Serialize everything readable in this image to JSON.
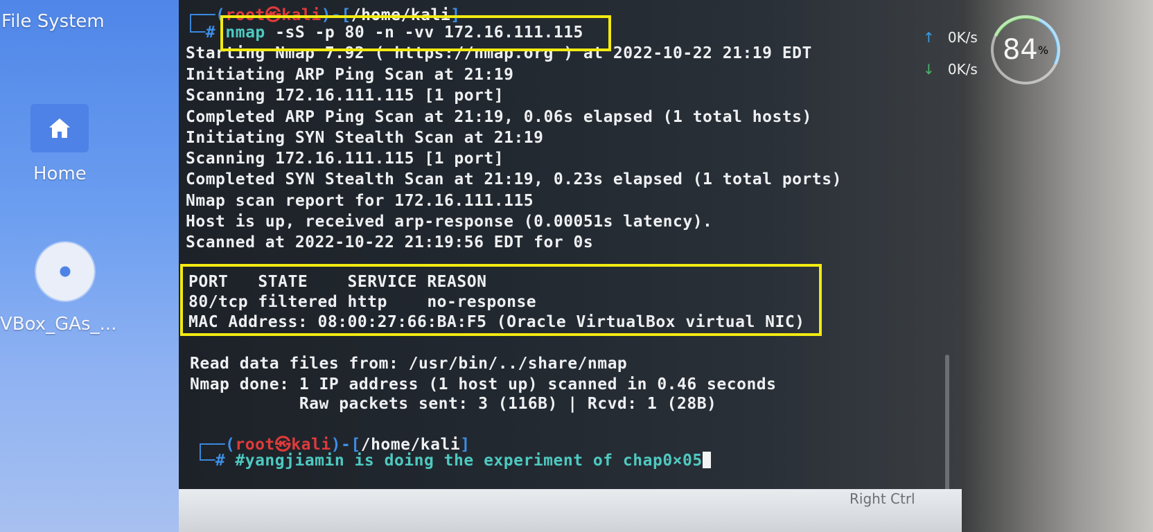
{
  "desktop": {
    "file_system": "File System",
    "home": "Home",
    "vbox": "VBox_GAs_..."
  },
  "terminal": {
    "prompt1": {
      "open": "┌──(",
      "user": "root㉿kali",
      "close": ")-[",
      "path": "/home/kali",
      "end": "]"
    },
    "command": {
      "hash": "└─# ",
      "cmd": "nmap",
      "rest": " -sS -p 80 -n -vv 172.16.111.115"
    },
    "output": [
      "Starting Nmap 7.92 ( https://nmap.org ) at 2022-10-22 21:19 EDT",
      "Initiating ARP Ping Scan at 21:19",
      "Scanning 172.16.111.115 [1 port]",
      "Completed ARP Ping Scan at 21:19, 0.06s elapsed (1 total hosts)",
      "Initiating SYN Stealth Scan at 21:19",
      "Scanning 172.16.111.115 [1 port]",
      "Completed SYN Stealth Scan at 21:19, 0.23s elapsed (1 total ports)",
      "Nmap scan report for 172.16.111.115",
      "Host is up, received arp-response (0.00051s latency).",
      "Scanned at 2022-10-22 21:19:56 EDT for 0s"
    ],
    "ports": [
      "PORT   STATE    SERVICE REASON",
      "80/tcp filtered http    no-response",
      "MAC Address: 08:00:27:66:BA:F5 (Oracle VirtualBox virtual NIC)"
    ],
    "tail": [
      "Read data files from: /usr/bin/../share/nmap",
      "Nmap done: 1 IP address (1 host up) scanned in 0.46 seconds",
      "           Raw packets sent: 3 (116B) | Rcvd: 1 (28B)"
    ],
    "prompt2": {
      "open": "┌──(",
      "user": "root㉿kali",
      "close": ")-[",
      "path": "/home/kali",
      "end": "]"
    },
    "input": {
      "hash": "└─# ",
      "text": "#yangjiamin is doing the experiment of chap0×05"
    }
  },
  "monitor": {
    "up_speed": "0K/s",
    "down_speed": "0K/s",
    "gauge_value": "84",
    "gauge_unit": "%"
  },
  "taskbar": {
    "host_key": "Right Ctrl"
  },
  "colors": {
    "highlight": "#f2ea12",
    "prompt_blue": "#3d8ee6",
    "prompt_red": "#e03a3a"
  }
}
